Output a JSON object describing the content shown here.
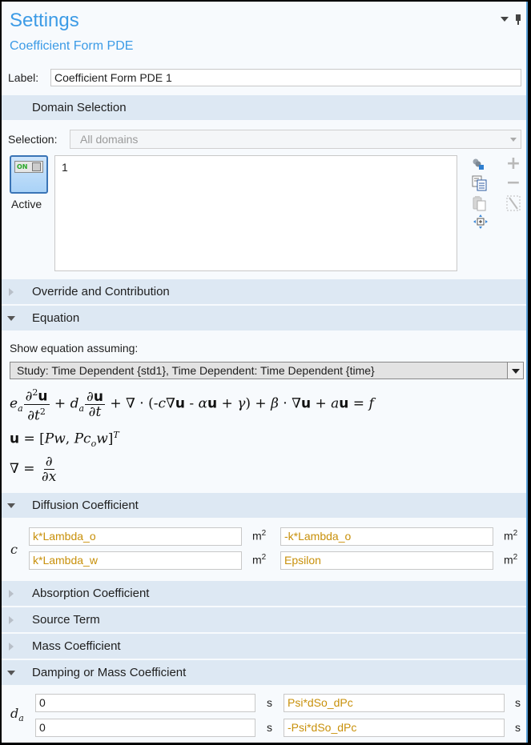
{
  "header": {
    "title": "Settings",
    "subtitle": "Coefficient Form PDE"
  },
  "label_field": {
    "label": "Label:",
    "value": "Coefficient Form PDE 1"
  },
  "domain_selection": {
    "section_title": "Domain Selection",
    "selection_label": "Selection:",
    "selection_value": "All domains",
    "active_toggle": {
      "state_text": "ON",
      "label": "Active",
      "on": true
    },
    "selected_items": [
      "1"
    ],
    "side_icons": [
      "select-box-icon",
      "copy-selection-icon",
      "paste-selection-icon",
      "zoom-to-selection-icon",
      "add-icon",
      "remove-icon",
      "clear-selection-icon"
    ]
  },
  "sections": {
    "override": "Override and Contribution",
    "equation": "Equation",
    "diffusion": "Diffusion Coefficient",
    "absorption": "Absorption Coefficient",
    "source": "Source Term",
    "mass": "Mass Coefficient",
    "damping": "Damping or Mass Coefficient"
  },
  "equation": {
    "show_label": "Show equation assuming:",
    "study_select": "Study: Time Dependent {std1}, Time Dependent: Time Dependent {time}",
    "main_equation": "e_a ∂²u/∂t² + d_a ∂u/∂t + ∇·(-c∇u - αu + γ) + β·∇u + au = f",
    "u_definition": "u = [Pw, Pc_ow]^T",
    "nabla_definition": "∇ = ∂/∂x"
  },
  "diffusion": {
    "symbol": "c",
    "unit": "m",
    "unit_exp": "2",
    "values": [
      [
        "k*Lambda_o",
        "-k*Lambda_o"
      ],
      [
        "k*Lambda_w",
        "Epsilon"
      ]
    ]
  },
  "damping": {
    "symbol": "d",
    "symbol_sub": "a",
    "unit": "s",
    "values": [
      [
        "0",
        "Psi*dSo_dPc"
      ],
      [
        "0",
        "-Psi*dSo_dPc"
      ]
    ]
  },
  "colors": {
    "title_blue": "#3c9be6",
    "section_bg": "#dde8f3",
    "expression_text": "#c8900a",
    "panel_bg": "#f7fafd"
  }
}
